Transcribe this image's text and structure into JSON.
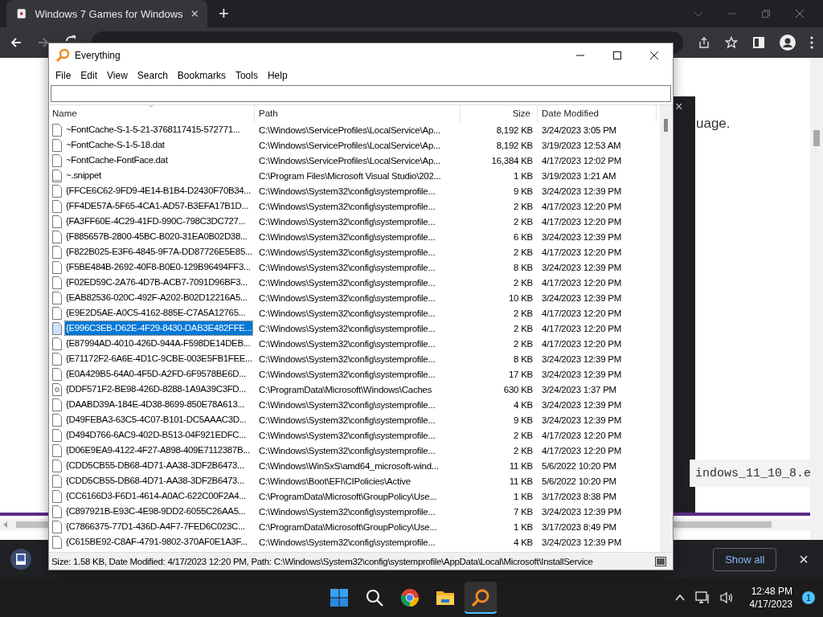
{
  "browser": {
    "tab_title": "Windows 7 Games for Windows",
    "new_tab": "+",
    "page_texts": [
      {
        "kind": "prose",
        "text": "uage."
      },
      {
        "kind": "code",
        "text": "indows_11_10_8.e"
      }
    ],
    "dialog_close": "×",
    "download_bar": {
      "show_all": "Show all",
      "close": "×"
    }
  },
  "window": {
    "title": "Everything",
    "menu": [
      "File",
      "Edit",
      "View",
      "Search",
      "Bookmarks",
      "Tools",
      "Help"
    ],
    "columns": [
      {
        "label": "Name",
        "kind": "name"
      },
      {
        "label": "Path",
        "kind": "path"
      },
      {
        "label": "Size",
        "kind": "size"
      },
      {
        "label": "Date Modified",
        "kind": "date"
      }
    ],
    "rows": [
      {
        "name": "~FontCache-S-1-5-21-3768117415-572771...",
        "path": "C:\\Windows\\ServiceProfiles\\LocalService\\Ap...",
        "size": "8,192 KB",
        "date": "3/24/2023 3:05 PM",
        "kind": "file",
        "selected": false
      },
      {
        "name": "~FontCache-S-1-5-18.dat",
        "path": "C:\\Windows\\ServiceProfiles\\LocalService\\Ap...",
        "size": "8,192 KB",
        "date": "3/19/2023 12:53 AM",
        "kind": "file",
        "selected": false
      },
      {
        "name": "~FontCache-FontFace.dat",
        "path": "C:\\Windows\\ServiceProfiles\\LocalService\\Ap...",
        "size": "16,384 KB",
        "date": "4/17/2023 12:02 PM",
        "kind": "file",
        "selected": false
      },
      {
        "name": "~.snippet",
        "path": "C:\\Program Files\\Microsoft Visual Studio\\202...",
        "size": "1 KB",
        "date": "3/19/2023 1:21 AM",
        "kind": "snippet",
        "selected": false
      },
      {
        "name": "{FFCE6C62-9FD9-4E14-B1B4-D2430F70B34...",
        "path": "C:\\Windows\\System32\\config\\systemprofile...",
        "size": "9 KB",
        "date": "3/24/2023 12:39 PM",
        "kind": "file",
        "selected": false
      },
      {
        "name": "{FF4DE57A-5F65-4CA1-AD57-B3EFA17B1D...",
        "path": "C:\\Windows\\System32\\config\\systemprofile...",
        "size": "2 KB",
        "date": "4/17/2023 12:20 PM",
        "kind": "file",
        "selected": false
      },
      {
        "name": "{FA3FF60E-4C29-41FD-990C-798C3DC727...",
        "path": "C:\\Windows\\System32\\config\\systemprofile...",
        "size": "2 KB",
        "date": "4/17/2023 12:20 PM",
        "kind": "file",
        "selected": false
      },
      {
        "name": "{F885657B-2800-45BC-B020-31EA0B02D38...",
        "path": "C:\\Windows\\System32\\config\\systemprofile...",
        "size": "6 KB",
        "date": "3/24/2023 12:39 PM",
        "kind": "file",
        "selected": false
      },
      {
        "name": "{F822B025-E3F6-4845-9F7A-DD87726E5E85...",
        "path": "C:\\Windows\\System32\\config\\systemprofile...",
        "size": "2 KB",
        "date": "4/17/2023 12:20 PM",
        "kind": "file",
        "selected": false
      },
      {
        "name": "{F5BE484B-2692-40F8-B0E0-129B96494FF3...",
        "path": "C:\\Windows\\System32\\config\\systemprofile...",
        "size": "8 KB",
        "date": "3/24/2023 12:39 PM",
        "kind": "file",
        "selected": false
      },
      {
        "name": "{F02ED59C-2A76-4D7B-ACB7-7091D96BF3...",
        "path": "C:\\Windows\\System32\\config\\systemprofile...",
        "size": "2 KB",
        "date": "4/17/2023 12:20 PM",
        "kind": "file",
        "selected": false
      },
      {
        "name": "{EAB82536-020C-492F-A202-B02D12216A5...",
        "path": "C:\\Windows\\System32\\config\\systemprofile...",
        "size": "10 KB",
        "date": "3/24/2023 12:39 PM",
        "kind": "file",
        "selected": false
      },
      {
        "name": "{E9E2D5AE-A0C5-4162-885E-C7A5A12765...",
        "path": "C:\\Windows\\System32\\config\\systemprofile...",
        "size": "2 KB",
        "date": "4/17/2023 12:20 PM",
        "kind": "file",
        "selected": false
      },
      {
        "name": "{E996C3EB-D62E-4F29-8430-DAB3E482FFE...",
        "path": "C:\\Windows\\System32\\config\\systemprofile...",
        "size": "2 KB",
        "date": "4/17/2023 12:20 PM",
        "kind": "file",
        "selected": true
      },
      {
        "name": "{E87994AD-4010-426D-944A-F598DE14DEB...",
        "path": "C:\\Windows\\System32\\config\\systemprofile...",
        "size": "2 KB",
        "date": "4/17/2023 12:20 PM",
        "kind": "file",
        "selected": false
      },
      {
        "name": "{E71172F2-6A6E-4D1C-9CBE-003E5FB1FEE...",
        "path": "C:\\Windows\\System32\\config\\systemprofile...",
        "size": "8 KB",
        "date": "3/24/2023 12:39 PM",
        "kind": "file",
        "selected": false
      },
      {
        "name": "{E0A429B5-64A0-4F5D-A2FD-6F9578BE6D...",
        "path": "C:\\Windows\\System32\\config\\systemprofile...",
        "size": "17 KB",
        "date": "3/24/2023 12:39 PM",
        "kind": "file",
        "selected": false
      },
      {
        "name": "{DDF571F2-BE98-426D-8288-1A9A39C3FD...",
        "path": "C:\\ProgramData\\Microsoft\\Windows\\Caches",
        "size": "630 KB",
        "date": "3/24/2023 1:37 PM",
        "kind": "config",
        "selected": false
      },
      {
        "name": "{DAABD39A-184E-4D38-8699-850E78A613...",
        "path": "C:\\Windows\\System32\\config\\systemprofile...",
        "size": "4 KB",
        "date": "3/24/2023 12:39 PM",
        "kind": "file",
        "selected": false
      },
      {
        "name": "{D49FEBA3-63C5-4C07-B101-DC5AAAC3D...",
        "path": "C:\\Windows\\System32\\config\\systemprofile...",
        "size": "9 KB",
        "date": "3/24/2023 12:39 PM",
        "kind": "file",
        "selected": false
      },
      {
        "name": "{D494D766-6AC9-402D-B513-04F921EDFC...",
        "path": "C:\\Windows\\System32\\config\\systemprofile...",
        "size": "2 KB",
        "date": "4/17/2023 12:20 PM",
        "kind": "file",
        "selected": false
      },
      {
        "name": "{D06E9EA9-4122-4F27-A898-409E7112387B...",
        "path": "C:\\Windows\\System32\\config\\systemprofile...",
        "size": "2 KB",
        "date": "4/17/2023 12:20 PM",
        "kind": "file",
        "selected": false
      },
      {
        "name": "{CDD5CB55-DB68-4D71-AA38-3DF2B6473...",
        "path": "C:\\Windows\\WinSxS\\amd64_microsoft-wind...",
        "size": "11 KB",
        "date": "5/6/2022 10:20 PM",
        "kind": "file",
        "selected": false
      },
      {
        "name": "{CDD5CB55-DB68-4D71-AA38-3DF2B6473...",
        "path": "C:\\Windows\\Boot\\EFI\\CIPolicies\\Active",
        "size": "11 KB",
        "date": "5/6/2022 10:20 PM",
        "kind": "file",
        "selected": false
      },
      {
        "name": "{CC6166D3-F6D1-4614-A0AC-622C00F2A4...",
        "path": "C:\\ProgramData\\Microsoft\\GroupPolicy\\Use...",
        "size": "1 KB",
        "date": "3/17/2023 8:38 PM",
        "kind": "file",
        "selected": false
      },
      {
        "name": "{C897921B-E93C-4E98-9DD2-6055C26AA5...",
        "path": "C:\\Windows\\System32\\config\\systemprofile...",
        "size": "7 KB",
        "date": "3/24/2023 12:39 PM",
        "kind": "file",
        "selected": false
      },
      {
        "name": "{C7866375-77D1-436D-A4F7-7FED6C023C...",
        "path": "C:\\ProgramData\\Microsoft\\GroupPolicy\\Use...",
        "size": "1 KB",
        "date": "3/17/2023 8:49 PM",
        "kind": "file",
        "selected": false
      },
      {
        "name": "{C615BE92-C8AF-4791-9802-370AF0E1A3F...",
        "path": "C:\\Windows\\System32\\config\\systemprofile...",
        "size": "4 KB",
        "date": "3/24/2023 12:39 PM",
        "kind": "file",
        "selected": false
      }
    ],
    "status": "Size: 1.58 KB, Date Modified: 4/17/2023 12:20 PM, Path: C:\\Windows\\System32\\config\\systemprofile\\AppData\\Local\\Microsoft\\InstallService"
  },
  "taskbar": {
    "apps": [
      {
        "kind": "start",
        "active": false
      },
      {
        "kind": "search",
        "active": false
      },
      {
        "kind": "chrome",
        "active": false
      },
      {
        "kind": "folder",
        "active": false
      },
      {
        "kind": "everything",
        "active": true
      }
    ],
    "time": "12:48 PM",
    "date": "4/17/2023",
    "badge": "1"
  }
}
